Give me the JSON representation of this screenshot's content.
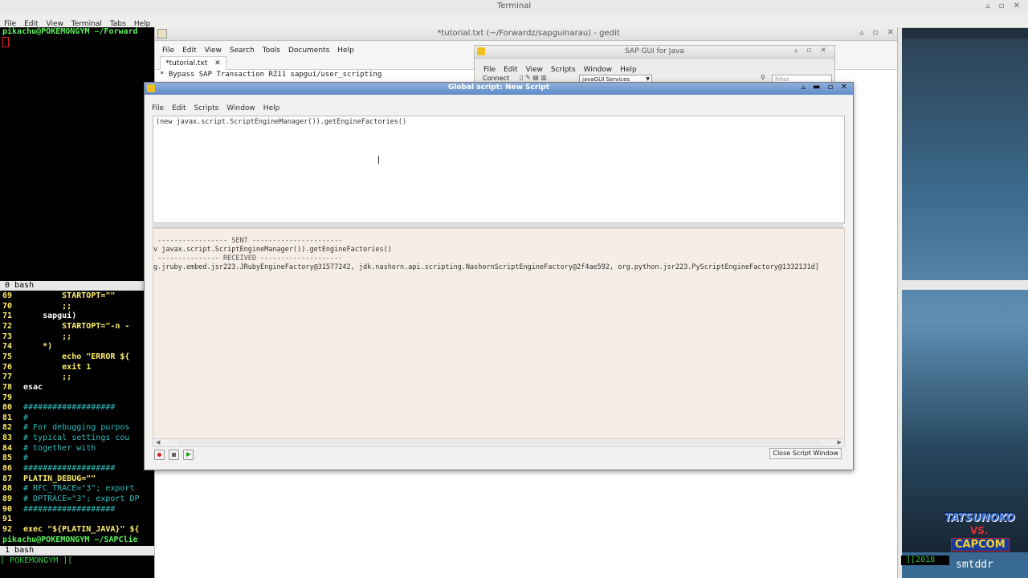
{
  "terminal": {
    "title": "Terminal",
    "menu": [
      "File",
      "Edit",
      "View",
      "Terminal",
      "Tabs",
      "Help"
    ],
    "prompt_top": "pikachu@POKEMONGYM ~/Forward",
    "pane_label_0": " 0 bash",
    "code_lines": [
      {
        "n": "69",
        "text": "        STARTOPT=\"\"",
        "cls": ""
      },
      {
        "n": "70",
        "text": "        ;;",
        "cls": ""
      },
      {
        "n": "71",
        "text": "    sapgui)",
        "cls": "kw"
      },
      {
        "n": "72",
        "text": "        STARTOPT=\"-n -",
        "cls": ""
      },
      {
        "n": "73",
        "text": "        ;;",
        "cls": ""
      },
      {
        "n": "74",
        "text": "    *)",
        "cls": ""
      },
      {
        "n": "75",
        "text": "        echo \"ERROR ${",
        "cls": ""
      },
      {
        "n": "76",
        "text": "        exit 1",
        "cls": ""
      },
      {
        "n": "77",
        "text": "        ;;",
        "cls": ""
      },
      {
        "n": "78",
        "text": "esac",
        "cls": "kw"
      },
      {
        "n": "79",
        "text": "",
        "cls": ""
      },
      {
        "n": "80",
        "text": "###################",
        "cls": "cm"
      },
      {
        "n": "81",
        "text": "#",
        "cls": "cm"
      },
      {
        "n": "82",
        "text": "# For debugging purpos",
        "cls": "cm"
      },
      {
        "n": "83",
        "text": "# typical settings cou",
        "cls": "cm"
      },
      {
        "n": "84",
        "text": "# together with",
        "cls": "cm"
      },
      {
        "n": "85",
        "text": "#",
        "cls": "cm"
      },
      {
        "n": "86",
        "text": "###################",
        "cls": "cm"
      },
      {
        "n": "87",
        "text": "PLATIN_DEBUG=\"\"",
        "cls": ""
      },
      {
        "n": "88",
        "text": "# RFC_TRACE=\"3\"; export",
        "cls": "cm"
      },
      {
        "n": "89",
        "text": "# DPTRACE=\"3\"; export DP",
        "cls": "cm"
      },
      {
        "n": "90",
        "text": "###################",
        "cls": "cm"
      },
      {
        "n": "91",
        "text": "",
        "cls": ""
      },
      {
        "n": "92",
        "text": "exec \"${PLATIN_JAVA}\" ${",
        "cls": ""
      }
    ],
    "prompt_bottom": "pikachu@POKEMONGYM ~/SAPClie",
    "pane_label_1": " 1 bash",
    "status": "[ POKEMONGYM ][",
    "status_right": " ][2018"
  },
  "gedit": {
    "title": "*tutorial.txt (~/Forwardz/sapguinarau) - gedit",
    "menu": [
      "File",
      "Edit",
      "View",
      "Search",
      "Tools",
      "Documents",
      "Help"
    ],
    "tab": "*tutorial.txt",
    "first_line": "* Bypass SAP Transaction RZ11 sapgui/user_scripting"
  },
  "sapgui": {
    "title": "SAP GUI for Java",
    "menu": [
      "File",
      "Edit",
      "View",
      "Scripts",
      "Window",
      "Help"
    ],
    "connect": "Connect",
    "services": "javaGUI Services",
    "filter_placeholder": "Filter"
  },
  "global_script": {
    "title": "Global script: New Script",
    "menu": [
      "File",
      "Edit",
      "Scripts",
      "Window",
      "Help"
    ],
    "editor_text": "(new javax.script.ScriptEngineManager()).getEngineFactories()",
    "output_lines": [
      " ----------------- SENT ----------------------",
      "v javax.script.ScriptEngineManager()).getEngineFactories()",
      " --------------- RECEIVED --------------------",
      "g.jruby.embed.jsr223.JRubyEngineFactory@31577242, jdk.nashorn.api.scripting.NashornScriptEngineFactory@2f4ae592, org.python.jsr223.PyScriptEngineFactory@1332131d]"
    ],
    "close_label": "Close Script Window"
  },
  "logo": {
    "brand_top": "TATSUNOKO",
    "brand_vs": "VS.",
    "brand_bottom": "CAPCOM",
    "signature": "smtddr"
  }
}
